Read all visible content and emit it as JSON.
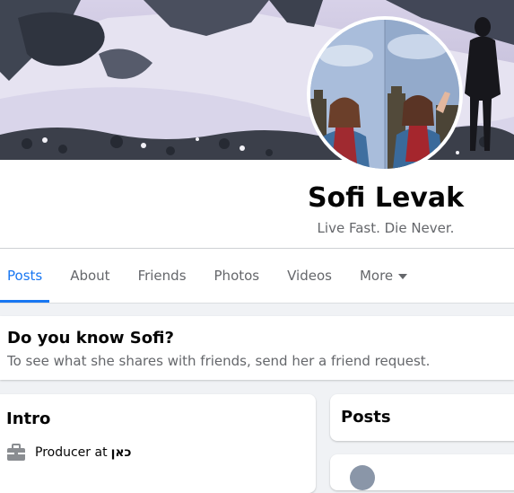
{
  "profile": {
    "name": "Sofi Levak",
    "bio": "Live Fast. Die Never."
  },
  "tabs": [
    {
      "label": "Posts",
      "active": true
    },
    {
      "label": "About"
    },
    {
      "label": "Friends"
    },
    {
      "label": "Photos"
    },
    {
      "label": "Videos"
    },
    {
      "label": "More",
      "icon": "caret-down-icon"
    }
  ],
  "know_card": {
    "title": "Do you know Sofi?",
    "subtitle": "To see what she shares with friends, send her a friend request."
  },
  "intro": {
    "title": "Intro",
    "work_prefix": "Producer at",
    "workplace": "כאן",
    "icon": "briefcase-icon"
  },
  "posts": {
    "title": "Posts"
  },
  "colors": {
    "accent": "#1877f2",
    "secondary_text": "#65676b",
    "background": "#f0f2f5"
  }
}
